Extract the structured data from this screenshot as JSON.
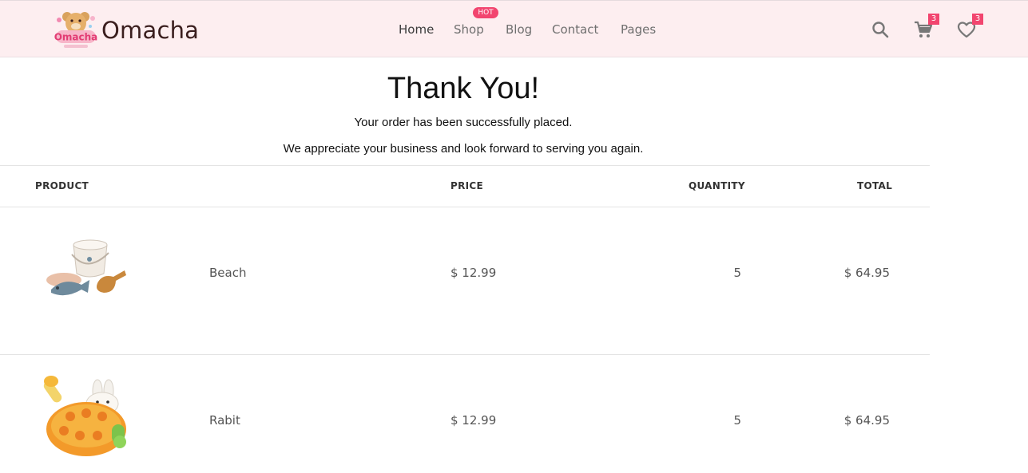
{
  "header": {
    "logo_text": "Omacha",
    "nav": [
      {
        "label": "Home"
      },
      {
        "label": "Shop"
      },
      {
        "label": "Blog"
      },
      {
        "label": "Contact"
      },
      {
        "label": "Pages"
      }
    ],
    "hot_badge": "HOT",
    "cart_count": "3",
    "wishlist_count": "3",
    "accent_color": "#f2456f",
    "header_bg": "#fdeef0"
  },
  "confirmation": {
    "title": "Thank You!",
    "message": "Your order has been successfully placed.",
    "sub_message": "We appreciate your business and look forward to serving you again."
  },
  "table": {
    "headers": {
      "product": "PRODUCT",
      "price": "PRICE",
      "quantity": "QUANTITY",
      "total": "TOTAL"
    },
    "rows": [
      {
        "image": "beach-toy-set-image",
        "name": "Beach",
        "price": "$ 12.99",
        "quantity": "5",
        "total": "$ 64.95"
      },
      {
        "image": "rabbit-whack-game-image",
        "name": "Rabit",
        "price": "$ 12.99",
        "quantity": "5",
        "total": "$ 64.95"
      }
    ]
  }
}
